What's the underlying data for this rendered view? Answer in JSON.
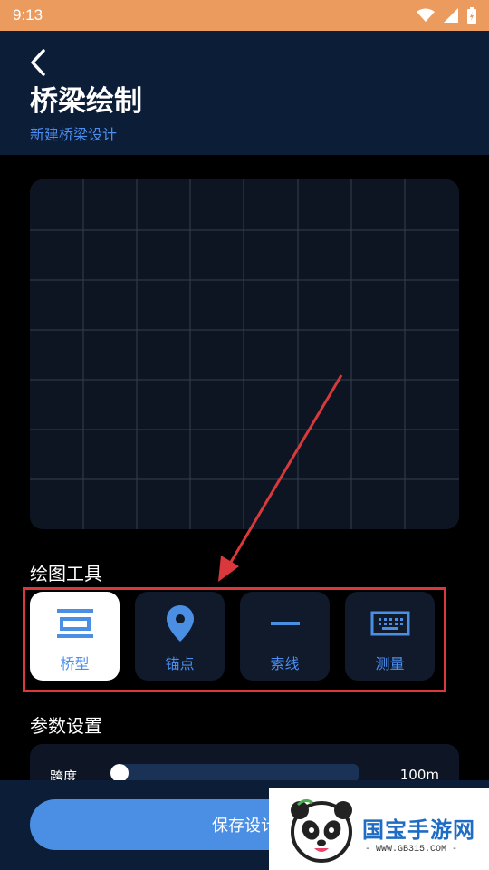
{
  "status_bar": {
    "time": "9:13"
  },
  "header": {
    "title": "桥梁绘制",
    "subtitle": "新建桥梁设计"
  },
  "tools_section": {
    "title": "绘图工具",
    "items": [
      {
        "label": "桥型",
        "icon": "bridge-type-icon",
        "active": true
      },
      {
        "label": "锚点",
        "icon": "location-pin-icon",
        "active": false
      },
      {
        "label": "索线",
        "icon": "line-icon",
        "active": false
      },
      {
        "label": "测量",
        "icon": "keyboard-icon",
        "active": false
      }
    ]
  },
  "params_section": {
    "title": "参数设置",
    "span": {
      "label": "跨度",
      "value": "100m",
      "slider_fraction": 0.0
    }
  },
  "save_button": {
    "label": "保存设计"
  },
  "watermark": {
    "brand": "国宝手游网",
    "url": "- WWW.GB315.COM -"
  },
  "colors": {
    "accent": "#4a8fe3",
    "header_bg": "#0c1d38",
    "status_bar": "#ec9b5f",
    "annotation_red": "#d9393c"
  }
}
